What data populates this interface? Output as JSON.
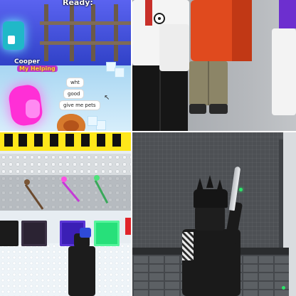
{
  "panel_top_left": {
    "banner_text": "Ready:",
    "player_name": "Cooper",
    "player_subtitle": "My Helping",
    "chat_bubbles": [
      "wht",
      "good",
      "give me pets"
    ]
  },
  "colors": {
    "panel1_bg": "#3a4bd8",
    "pink_pet": "#ff2fd6",
    "red_shirt": "#e04a1e",
    "sign_yellow": "#ffe71a",
    "dark_wall": "#4d5054",
    "glow_green": "#2de36a"
  },
  "icons": [
    "cursor-icon",
    "egg-icon",
    "pet-icon",
    "donut-icon",
    "arrow-icon",
    "sword-icon"
  ]
}
